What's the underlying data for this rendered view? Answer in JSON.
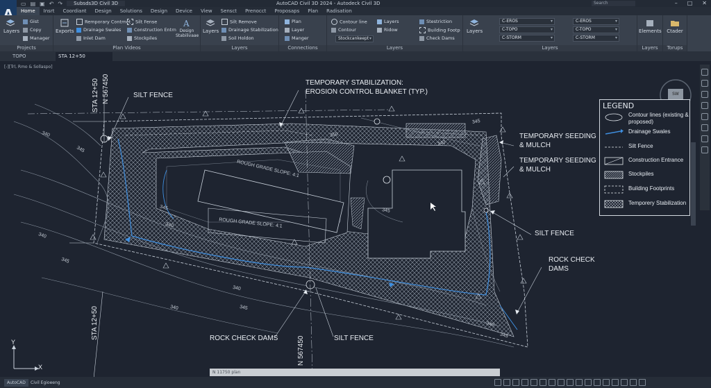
{
  "app": {
    "logo": "A",
    "title": "AutoCAD Civil 3D 2024 - Autodeck Civil 3D",
    "workspace": "Subsds3D Civil 3D",
    "search_placeholder": "Search"
  },
  "tabs": [
    "Home",
    "Insrt",
    "Coordiant",
    "Design",
    "Solutions",
    "Design",
    "Device",
    "View",
    "Sensct",
    "Prenocct",
    "Proposaps",
    "Plan",
    "Radisation"
  ],
  "ribbon": {
    "palettes": {
      "big_label": "Layers",
      "items": [
        "Gist",
        "Copy",
        "Manager"
      ],
      "title": "Projects"
    },
    "create_design": {
      "big_label": "Exports",
      "items": [
        "Remporary Contrnet",
        "Drainage Swales",
        "Inlet Dam"
      ],
      "items2": [
        "Silt Fense",
        "Construction Entrn",
        "Stockpiles"
      ],
      "big2": "Design Stabilivaae",
      "title": "Plan Videos"
    },
    "modify": {
      "big_label": "Layers",
      "items": [
        "Silt Remove",
        "Drainage Stabilization",
        "Soil Holdon"
      ],
      "title": "Layers"
    },
    "connections": {
      "items": [
        "Plan",
        "Layer",
        "Manger"
      ],
      "title": "Connections"
    },
    "layers1": {
      "items": [
        "Contour line",
        "Contour",
        "Stockcankeept"
      ],
      "items2": [
        "Layers",
        "Ridow"
      ],
      "items3": [
        "Stestriction",
        "Building Footp",
        "Check Dams"
      ],
      "title": "Layers"
    },
    "layers2": {
      "big_label": "Layers",
      "combos": [
        "C-EROS",
        "C-TOPO",
        "C-STORM"
      ],
      "combos2": [
        "C-EROS",
        "C-TOPO",
        "C-STORM"
      ],
      "title": "Layers"
    },
    "elements": {
      "label": "Elements",
      "title": "Layers"
    },
    "tools": {
      "label": "Ctader",
      "title": "Torups"
    }
  },
  "doc_tabs": [
    "TOPO",
    "STA 12+50"
  ],
  "viewport_label": "[-][Trl, Rmo & Sollaspo]",
  "drawing": {
    "labels": {
      "temp_stab": "TEMPORARY STABILIZATION:",
      "erosion_blanket": "EROSION CONTROL BLANKET (TYP.)",
      "silt_fence_top": "SILT FENCE",
      "temp_seed1": "TEMPORARY SEEDING",
      "mulch1": "& MULCH",
      "temp_seed2": "TEMPORARY SEEDING",
      "mulch2": "& MULCH",
      "silt_fence_right": "SILT FENCE",
      "rock_check": "ROCK CHECK",
      "dams": "DAMS",
      "rock_check_dams": "ROCK CHECK DAMS",
      "silt_fence_bottom": "SILT FENCE",
      "rough_grade1": "ROUGH GRADE SLOPE: 4:1",
      "rough_grade2": "ROUGH GRADE SLOPE: 4:1",
      "sta_top": "STA 12+50",
      "n_top": "N 567450",
      "sta_bottom": "STA 12+50",
      "n_bottom": "N 567450"
    },
    "contours": [
      "340",
      "345",
      "340",
      "345",
      "340",
      "345",
      "340",
      "345",
      "340",
      "350",
      "345",
      "340",
      "345",
      "340",
      "345"
    ]
  },
  "legend": {
    "title": "LEGEND",
    "items": [
      "Contour lines (existing & proposed)",
      "Drainage Swales",
      "Silt Fence",
      "Construction Entrance",
      "Stockpiles",
      "Building Footprints",
      "Temporery Stabilization"
    ]
  },
  "compass": {
    "label": "SW"
  },
  "ucs": {
    "x": "X",
    "y": "Y"
  },
  "command_line": "N 11750 plan",
  "status_tabs": [
    "AutoCAD",
    "Civil Egioeeng"
  ],
  "colors": {
    "accent": "#3f8fe0",
    "background": "#1e2430",
    "linework": "#c9d1db"
  }
}
